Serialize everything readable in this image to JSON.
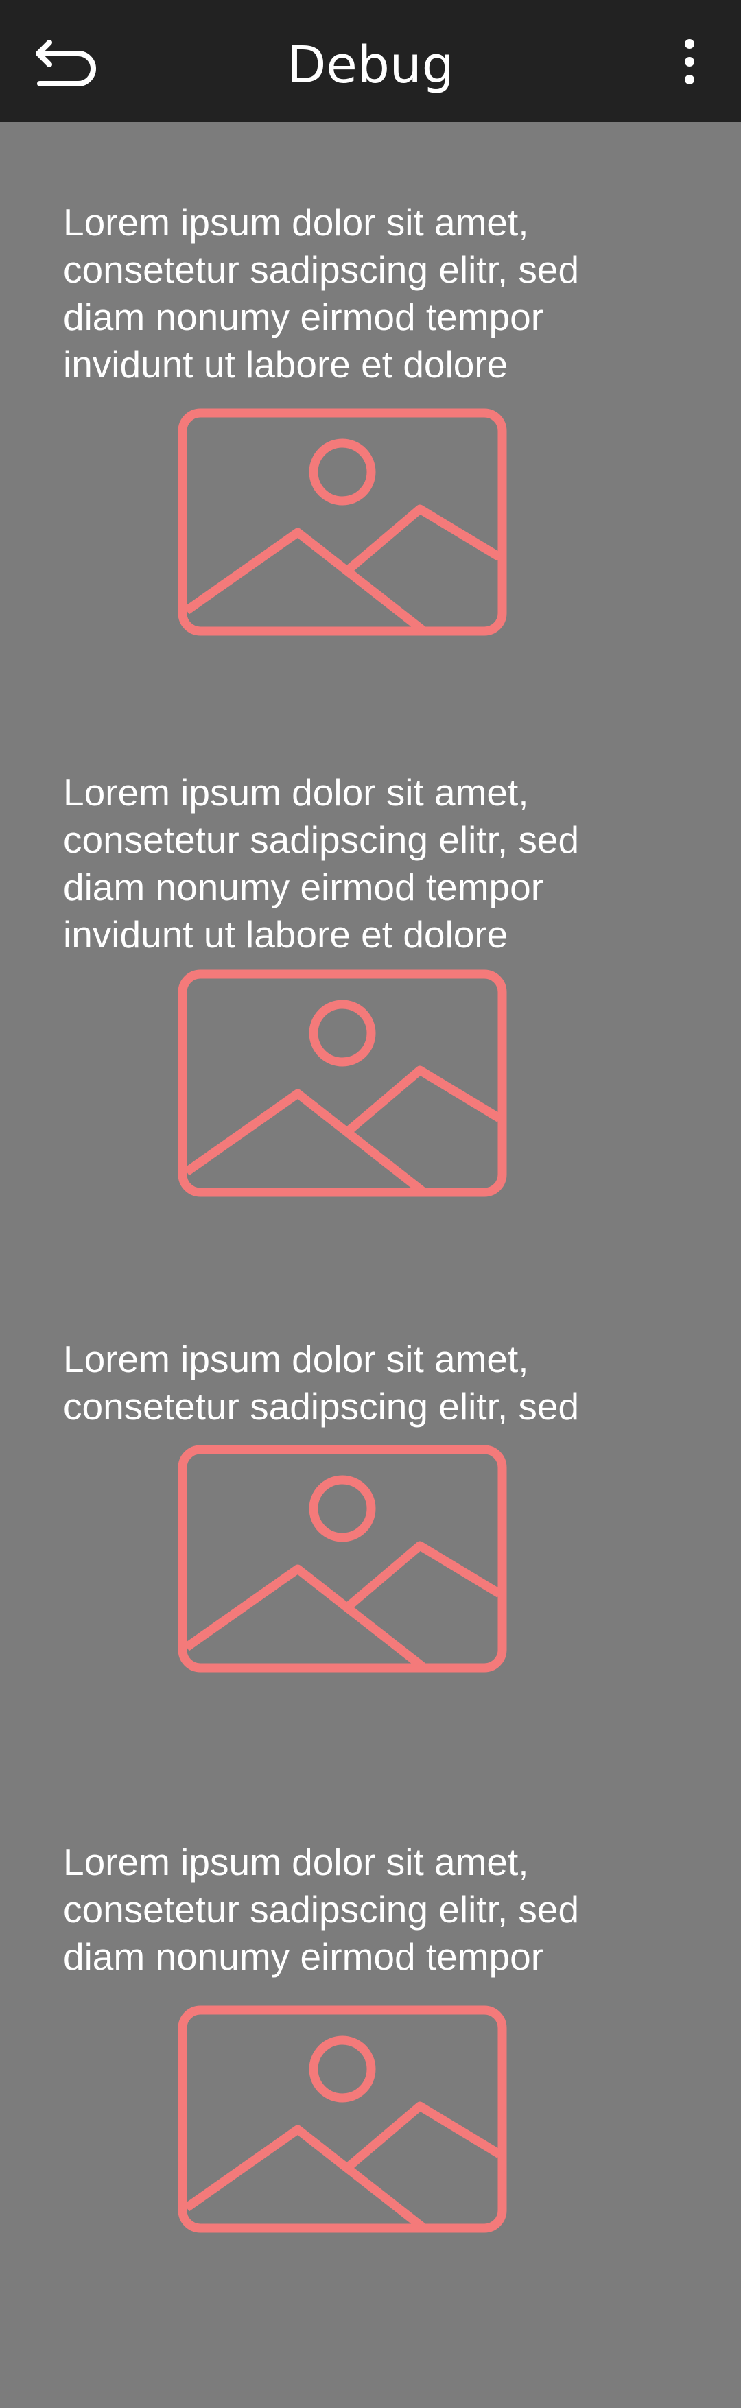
{
  "appbar": {
    "title": "Debug",
    "back_icon": "back-arrow-icon",
    "menu_icon": "more-vert-icon",
    "background": "#222222"
  },
  "list": {
    "background": "#7c7c7c",
    "placeholder_icon": "image-placeholder-icon",
    "placeholder_color": "#f47a7a",
    "items": [
      {
        "text": "Lorem ipsum dolor sit amet,\nconsetetur sadipscing elitr, sed\ndiam nonumy eirmod tempor\ninvidunt ut labore et dolore"
      },
      {
        "text": "Lorem ipsum dolor sit amet,\nconsetetur sadipscing elitr, sed\ndiam nonumy eirmod tempor\ninvidunt ut labore et dolore"
      },
      {
        "text": "Lorem ipsum dolor sit amet,\nconsetetur sadipscing elitr, sed"
      },
      {
        "text": "Lorem ipsum dolor sit amet,\nconsetetur sadipscing elitr, sed\ndiam nonumy eirmod tempor"
      }
    ]
  }
}
